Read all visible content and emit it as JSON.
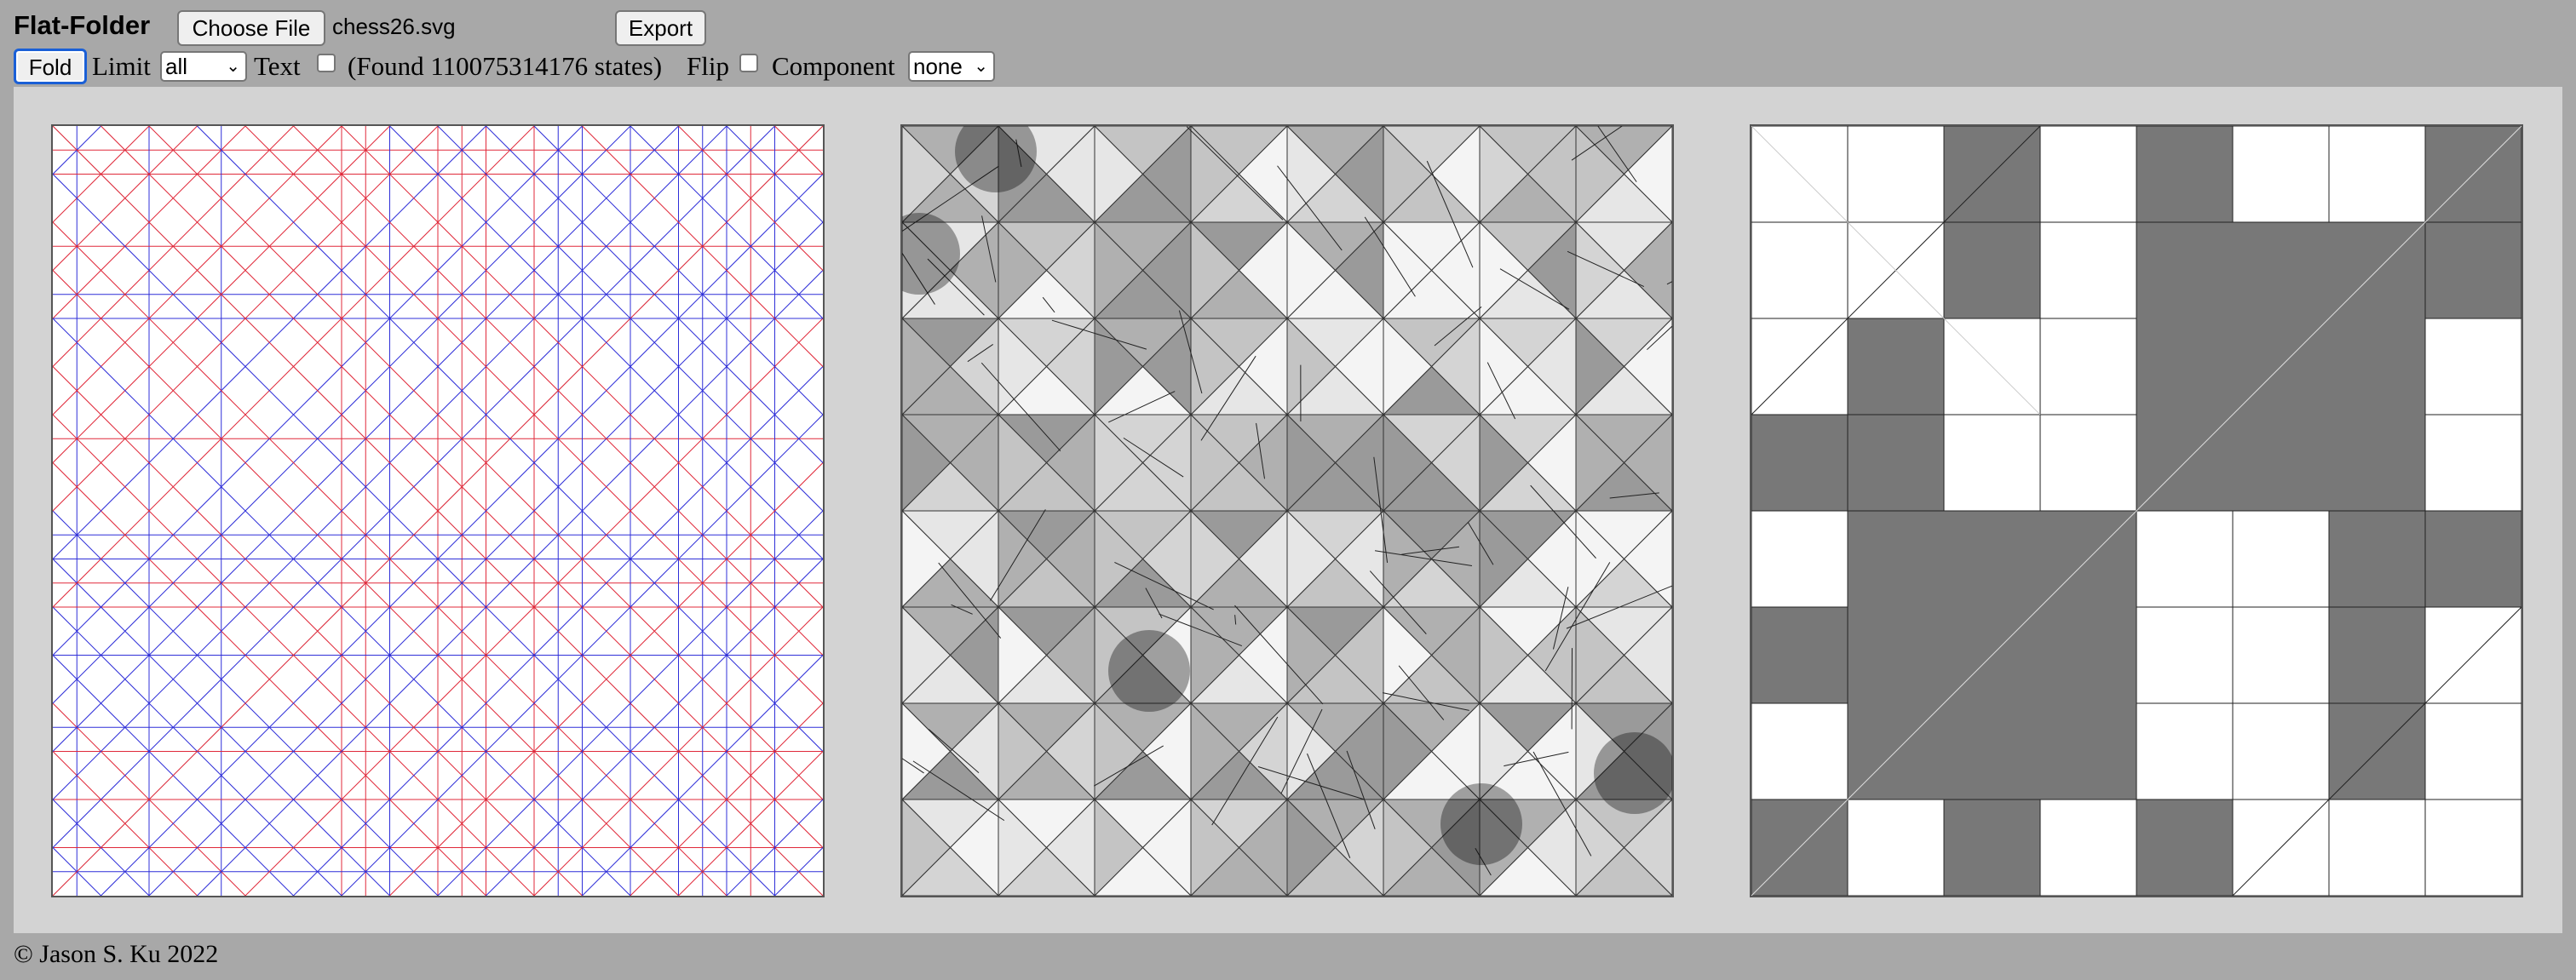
{
  "header": {
    "app_title": "Flat-Folder",
    "choose_file_label": "Choose File",
    "file_name": "chess26.svg",
    "export_label": "Export"
  },
  "controls": {
    "fold_label": "Fold",
    "limit_label": "Limit",
    "limit_value": "all",
    "text_label": "Text",
    "text_checked": false,
    "states_text": "(Found 110075314176 states)",
    "flip_label": "Flip",
    "flip_checked": false,
    "component_label": "Component",
    "component_value": "none"
  },
  "views": {
    "crease_pattern": "crease-pattern-view",
    "x_ray": "overlap-xray-view",
    "folded_state": "folded-state-view"
  },
  "colors": {
    "mountain": "#e0293a",
    "valley": "#2f2fd8",
    "folded_dark": "#787878",
    "folded_light": "#ffffff",
    "panel_bg": "#d3d3d3",
    "page_bg": "#a8a8a8"
  },
  "footer": {
    "copyright": "© Jason S. Ku 2022"
  }
}
